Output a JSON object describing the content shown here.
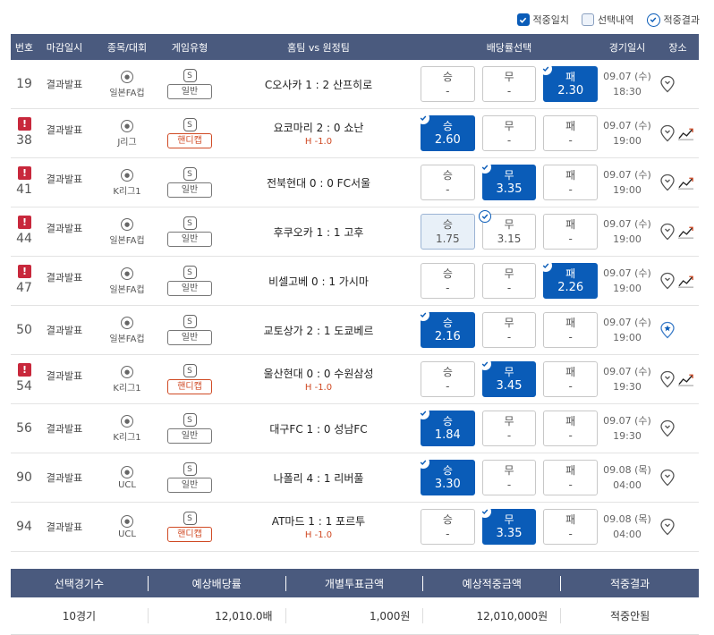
{
  "legend": {
    "match_same": "적중일치",
    "selection": "선택내역",
    "hit_result": "적중결과"
  },
  "headers": [
    "번호",
    "마감일시",
    "종목/대회",
    "게임유형",
    "홈팀 vs 원정팀",
    "배당률선택",
    "경기일시",
    "장소"
  ],
  "rows": [
    {
      "no": "19",
      "warn": false,
      "close": "결과발표",
      "league": "일본FA컵",
      "type": "일반",
      "handicap": false,
      "match": "C오사카 1 : 2 산프히로",
      "sub": "",
      "odds": [
        {
          "label": "승",
          "value": "-",
          "state": "none",
          "check": false
        },
        {
          "label": "무",
          "value": "-",
          "state": "none",
          "check": false
        },
        {
          "label": "패",
          "value": "2.30",
          "state": "sel",
          "check": true
        }
      ],
      "date": "09.07 (수)",
      "time": "18:30",
      "venue": "pin",
      "chart": false
    },
    {
      "no": "38",
      "warn": true,
      "close": "결과발표",
      "league": "J리그",
      "type": "핸디캡",
      "handicap": true,
      "match": "요코마리 2 : 0 쇼난",
      "sub": "H -1.0",
      "odds": [
        {
          "label": "승",
          "value": "2.60",
          "state": "sel",
          "check": true
        },
        {
          "label": "무",
          "value": "-",
          "state": "none",
          "check": false
        },
        {
          "label": "패",
          "value": "-",
          "state": "none",
          "check": false
        }
      ],
      "date": "09.07 (수)",
      "time": "19:00",
      "venue": "pin",
      "chart": true
    },
    {
      "no": "41",
      "warn": true,
      "close": "결과발표",
      "league": "K리그1",
      "type": "일반",
      "handicap": false,
      "match": "전북현대 0 : 0 FC서울",
      "sub": "",
      "odds": [
        {
          "label": "승",
          "value": "-",
          "state": "none",
          "check": false
        },
        {
          "label": "무",
          "value": "3.35",
          "state": "sel",
          "check": true
        },
        {
          "label": "패",
          "value": "-",
          "state": "none",
          "check": false
        }
      ],
      "date": "09.07 (수)",
      "time": "19:00",
      "venue": "pin",
      "chart": true
    },
    {
      "no": "44",
      "warn": true,
      "close": "결과발표",
      "league": "일본FA컵",
      "type": "일반",
      "handicap": false,
      "match": "후쿠오카 1 : 1 고후",
      "sub": "",
      "odds": [
        {
          "label": "승",
          "value": "1.75",
          "state": "hl",
          "check": false
        },
        {
          "label": "무",
          "value": "3.15",
          "state": "none",
          "check": true
        },
        {
          "label": "패",
          "value": "-",
          "state": "none",
          "check": false
        }
      ],
      "date": "09.07 (수)",
      "time": "19:00",
      "venue": "pin",
      "chart": true
    },
    {
      "no": "47",
      "warn": true,
      "close": "결과발표",
      "league": "일본FA컵",
      "type": "일반",
      "handicap": false,
      "match": "비셀고베 0 : 1 가시마",
      "sub": "",
      "odds": [
        {
          "label": "승",
          "value": "-",
          "state": "none",
          "check": false
        },
        {
          "label": "무",
          "value": "-",
          "state": "none",
          "check": false
        },
        {
          "label": "패",
          "value": "2.26",
          "state": "sel",
          "check": true
        }
      ],
      "date": "09.07 (수)",
      "time": "19:00",
      "venue": "pin",
      "chart": true
    },
    {
      "no": "50",
      "warn": false,
      "close": "결과발표",
      "league": "일본FA컵",
      "type": "일반",
      "handicap": false,
      "match": "교토상가 2 : 1 도쿄베르",
      "sub": "",
      "odds": [
        {
          "label": "승",
          "value": "2.16",
          "state": "sel",
          "check": true
        },
        {
          "label": "무",
          "value": "-",
          "state": "none",
          "check": false
        },
        {
          "label": "패",
          "value": "-",
          "state": "none",
          "check": false
        }
      ],
      "date": "09.07 (수)",
      "time": "19:00",
      "venue": "star",
      "chart": false
    },
    {
      "no": "54",
      "warn": true,
      "close": "결과발표",
      "league": "K리그1",
      "type": "핸디캡",
      "handicap": true,
      "match": "울산현대 0 : 0 수원삼성",
      "sub": "H -1.0",
      "odds": [
        {
          "label": "승",
          "value": "-",
          "state": "none",
          "check": false
        },
        {
          "label": "무",
          "value": "3.45",
          "state": "sel",
          "check": true
        },
        {
          "label": "패",
          "value": "-",
          "state": "none",
          "check": false
        }
      ],
      "date": "09.07 (수)",
      "time": "19:30",
      "venue": "pin",
      "chart": true
    },
    {
      "no": "56",
      "warn": false,
      "close": "결과발표",
      "league": "K리그1",
      "type": "일반",
      "handicap": false,
      "match": "대구FC 1 : 0 성남FC",
      "sub": "",
      "odds": [
        {
          "label": "승",
          "value": "1.84",
          "state": "sel",
          "check": true
        },
        {
          "label": "무",
          "value": "-",
          "state": "none",
          "check": false
        },
        {
          "label": "패",
          "value": "-",
          "state": "none",
          "check": false
        }
      ],
      "date": "09.07 (수)",
      "time": "19:30",
      "venue": "pin",
      "chart": false
    },
    {
      "no": "90",
      "warn": false,
      "close": "결과발표",
      "league": "UCL",
      "type": "일반",
      "handicap": false,
      "match": "나폴리 4 : 1 리버풀",
      "sub": "",
      "odds": [
        {
          "label": "승",
          "value": "3.30",
          "state": "sel",
          "check": true
        },
        {
          "label": "무",
          "value": "-",
          "state": "none",
          "check": false
        },
        {
          "label": "패",
          "value": "-",
          "state": "none",
          "check": false
        }
      ],
      "date": "09.08 (목)",
      "time": "04:00",
      "venue": "pin",
      "chart": false
    },
    {
      "no": "94",
      "warn": false,
      "close": "결과발표",
      "league": "UCL",
      "type": "핸디캡",
      "handicap": true,
      "match": "AT마드 1 : 1 포르투",
      "sub": "H -1.0",
      "odds": [
        {
          "label": "승",
          "value": "-",
          "state": "none",
          "check": false
        },
        {
          "label": "무",
          "value": "3.35",
          "state": "sel",
          "check": true
        },
        {
          "label": "패",
          "value": "-",
          "state": "none",
          "check": false
        }
      ],
      "date": "09.08 (목)",
      "time": "04:00",
      "venue": "pin",
      "chart": false
    }
  ],
  "summary": {
    "headers": [
      "선택경기수",
      "예상배당률",
      "개별투표금액",
      "예상적중금액",
      "적중결과"
    ],
    "values": [
      "10경기",
      "12,010.0배",
      "1,000원",
      "12,010,000원",
      "적중안됨"
    ]
  },
  "colors": {
    "header_bg": "#4a5a7e",
    "selected": "#0a5cb8",
    "handicap": "#d04a24",
    "warning": "#c8283c"
  },
  "icons": {
    "warning": "warning-icon",
    "ball": "soccer-ball-icon",
    "s": "s-badge-icon",
    "check": "check-icon",
    "pin": "map-pin-icon",
    "star": "star-pin-icon",
    "chart": "trend-chart-icon"
  }
}
